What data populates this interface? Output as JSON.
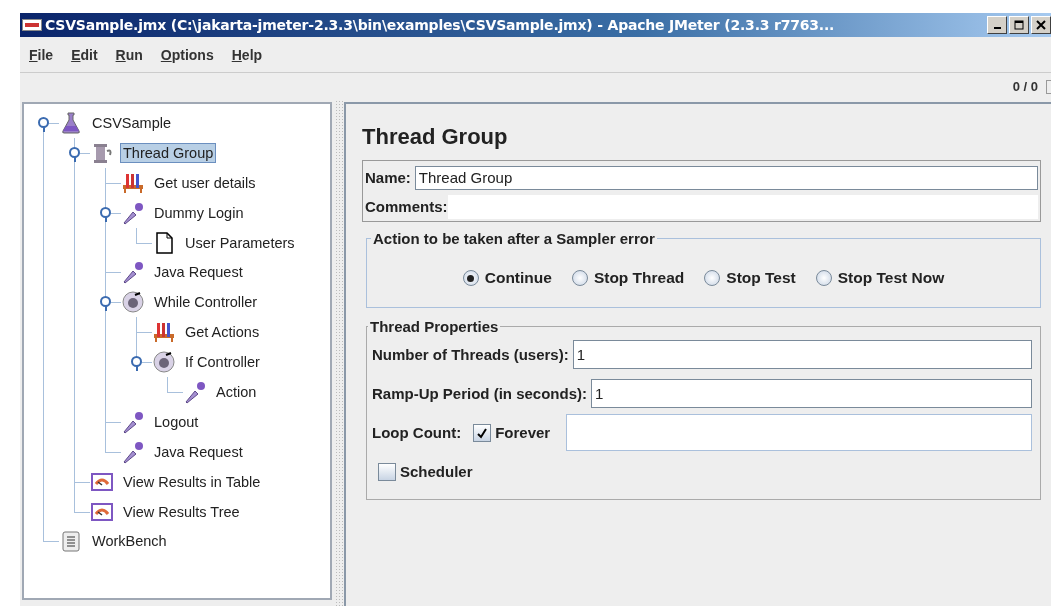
{
  "window": {
    "title": "CSVSample.jmx (C:\\jakarta-jmeter-2.3.3\\bin\\examples\\CSVSample.jmx) - Apache JMeter (2.3.3 r7763..."
  },
  "menu": [
    "File",
    "Edit",
    "Run",
    "Options",
    "Help"
  ],
  "toolbar": {
    "counter": "0 / 0"
  },
  "tree": [
    {
      "label": "CSVSample",
      "kind": "plan",
      "selected": false,
      "expanded": true,
      "children": [
        {
          "label": "Thread Group",
          "kind": "threads",
          "selected": true,
          "expanded": true,
          "children": [
            {
              "label": "Get user details",
              "kind": "config",
              "selected": false
            },
            {
              "label": "Dummy Login",
              "kind": "sampler",
              "selected": false,
              "expanded": true,
              "children": [
                {
                  "label": "User Parameters",
                  "kind": "page",
                  "selected": false
                }
              ]
            },
            {
              "label": "Java Request",
              "kind": "sampler",
              "selected": false
            },
            {
              "label": "While Controller",
              "kind": "controller",
              "selected": false,
              "expanded": true,
              "children": [
                {
                  "label": "Get Actions",
                  "kind": "config",
                  "selected": false
                },
                {
                  "label": "If Controller",
                  "kind": "controller",
                  "selected": false,
                  "expanded": true,
                  "children": [
                    {
                      "label": "Action",
                      "kind": "sampler",
                      "selected": false
                    }
                  ]
                }
              ]
            },
            {
              "label": "Logout",
              "kind": "sampler",
              "selected": false
            },
            {
              "label": "Java Request",
              "kind": "sampler",
              "selected": false
            }
          ]
        },
        {
          "label": "View Results in Table",
          "kind": "listener",
          "selected": false
        },
        {
          "label": "View Results Tree",
          "kind": "listener",
          "selected": false
        }
      ]
    },
    {
      "label": "WorkBench",
      "kind": "workbench",
      "selected": false
    }
  ],
  "panel": {
    "title": "Thread Group",
    "name_label": "Name:",
    "name_value": "Thread Group",
    "comments_label": "Comments:",
    "error_group": {
      "title": "Action to be taken after a Sampler error",
      "options": [
        {
          "label": "Continue",
          "selected": true
        },
        {
          "label": "Stop Thread",
          "selected": false
        },
        {
          "label": "Stop Test",
          "selected": false
        },
        {
          "label": "Stop Test Now",
          "selected": false
        }
      ]
    },
    "properties": {
      "title": "Thread Properties",
      "threads_label": "Number of Threads (users):",
      "threads_value": "1",
      "rampup_label": "Ramp-Up Period (in seconds):",
      "rampup_value": "1",
      "loop_label": "Loop Count:",
      "forever": {
        "label": "Forever",
        "checked": true
      },
      "scheduler": {
        "label": "Scheduler",
        "checked": false
      }
    }
  }
}
